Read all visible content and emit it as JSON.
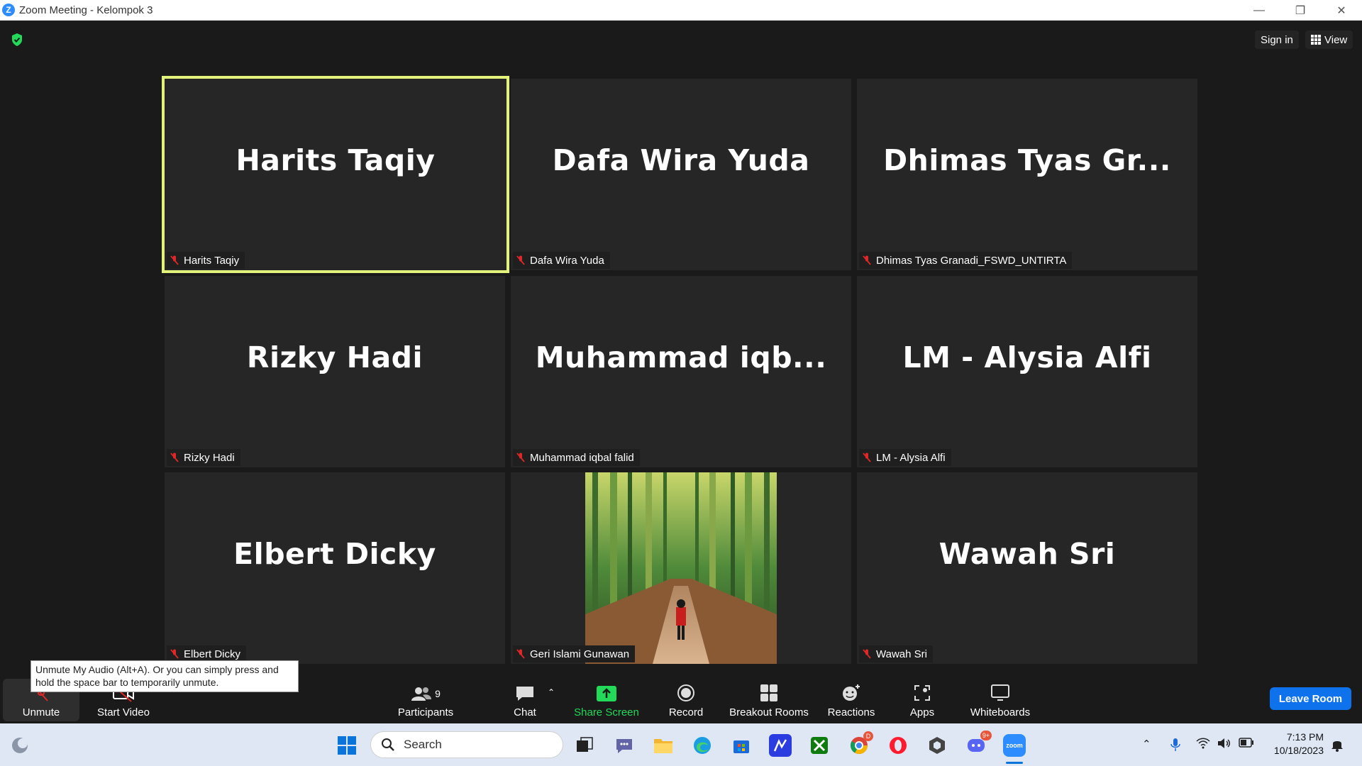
{
  "window": {
    "title": "Zoom Meeting - Kelompok 3",
    "logo_letter": "Z"
  },
  "header": {
    "sign_in": "Sign in",
    "view": "View"
  },
  "tiles": [
    {
      "display": "Harits Taqiy",
      "label": "Harits Taqiy",
      "active": true
    },
    {
      "display": "Dafa Wira Yuda",
      "label": "Dafa Wira Yuda"
    },
    {
      "display": "Dhimas  Tyas  Gr...",
      "label": "Dhimas Tyas Granadi_FSWD_UNTIRTA"
    },
    {
      "display": "Rizky Hadi",
      "label": "Rizky Hadi"
    },
    {
      "display": "Muhammad  iqb...",
      "label": "Muhammad iqbal falid"
    },
    {
      "display": "LM - Alysia Alfi",
      "label": "LM - Alysia Alfi"
    },
    {
      "display": "Elbert Dicky",
      "label": "Elbert Dicky"
    },
    {
      "display": "",
      "label": "Geri Islami Gunawan",
      "video": true
    },
    {
      "display": "Wawah Sri",
      "label": "Wawah Sri"
    }
  ],
  "tooltip": "Unmute My Audio (Alt+A). Or you can simply press and hold the space bar to temporarily unmute.",
  "toolbar": {
    "unmute": "Unmute",
    "start_video": "Start Video",
    "participants": "Participants",
    "participants_count": "9",
    "chat": "Chat",
    "share_screen": "Share Screen",
    "record": "Record",
    "breakout_rooms": "Breakout Rooms",
    "reactions": "Reactions",
    "apps": "Apps",
    "whiteboards": "Whiteboards",
    "leave_room": "Leave Room"
  },
  "taskbar": {
    "search_placeholder": "Search",
    "time": "7:13 PM",
    "date": "10/18/2023",
    "chrome_badge": "D",
    "discord_badge": "9+",
    "zoom_label": "zoom"
  },
  "colors": {
    "active_border": "#e3f27a",
    "leave_button": "#0e72ed",
    "share_green": "#23d959",
    "muted_red": "#e02828"
  }
}
